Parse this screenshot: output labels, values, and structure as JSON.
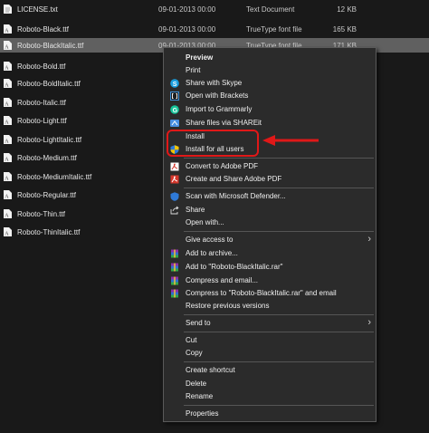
{
  "files": [
    {
      "name": "LICENSE.txt",
      "date": "09-01-2013 00:00",
      "type": "Text Document",
      "size": "12 KB"
    },
    {
      "name": "Roboto-Black.ttf",
      "date": "09-01-2013 00:00",
      "type": "TrueType font file",
      "size": "165 KB"
    },
    {
      "name": "Roboto-BlackItalic.ttf",
      "date": "09-01-2013 00:00",
      "type": "TrueType font file",
      "size": "171 KB",
      "selected": true
    },
    {
      "name": "Roboto-Bold.ttf"
    },
    {
      "name": "Roboto-BoldItalic.ttf"
    },
    {
      "name": "Roboto-Italic.ttf"
    },
    {
      "name": "Roboto-Light.ttf"
    },
    {
      "name": "Roboto-LightItalic.ttf"
    },
    {
      "name": "Roboto-Medium.ttf"
    },
    {
      "name": "Roboto-MediumItalic.ttf"
    },
    {
      "name": "Roboto-Regular.ttf"
    },
    {
      "name": "Roboto-Thin.ttf"
    },
    {
      "name": "Roboto-ThinItalic.ttf"
    }
  ],
  "context_menu": {
    "preview": "Preview",
    "print": "Print",
    "share_skype": "Share with Skype",
    "open_brackets": "Open with Brackets",
    "import_grammarly": "Import to Grammarly",
    "share_shareit": "Share files via SHAREit",
    "install": "Install",
    "install_all_users": "Install for all users",
    "convert_pdf": "Convert to Adobe PDF",
    "create_share_pdf": "Create and Share Adobe PDF",
    "scan_defender": "Scan with Microsoft Defender...",
    "share": "Share",
    "open_with": "Open with...",
    "give_access": "Give access to",
    "add_archive": "Add to archive...",
    "add_rar": "Add to \"Roboto-BlackItalic.rar\"",
    "compress_email": "Compress and email...",
    "compress_rar_email": "Compress to \"Roboto-BlackItalic.rar\" and email",
    "restore_versions": "Restore previous versions",
    "send_to": "Send to",
    "cut": "Cut",
    "copy": "Copy",
    "create_shortcut": "Create shortcut",
    "delete": "Delete",
    "rename": "Rename",
    "properties": "Properties"
  },
  "colors": {
    "highlight": "#e01818",
    "skype": "#1a9fe0",
    "grammarly": "#15c39a",
    "pdf": "#d4372c",
    "defender": "#2f7ad8"
  }
}
